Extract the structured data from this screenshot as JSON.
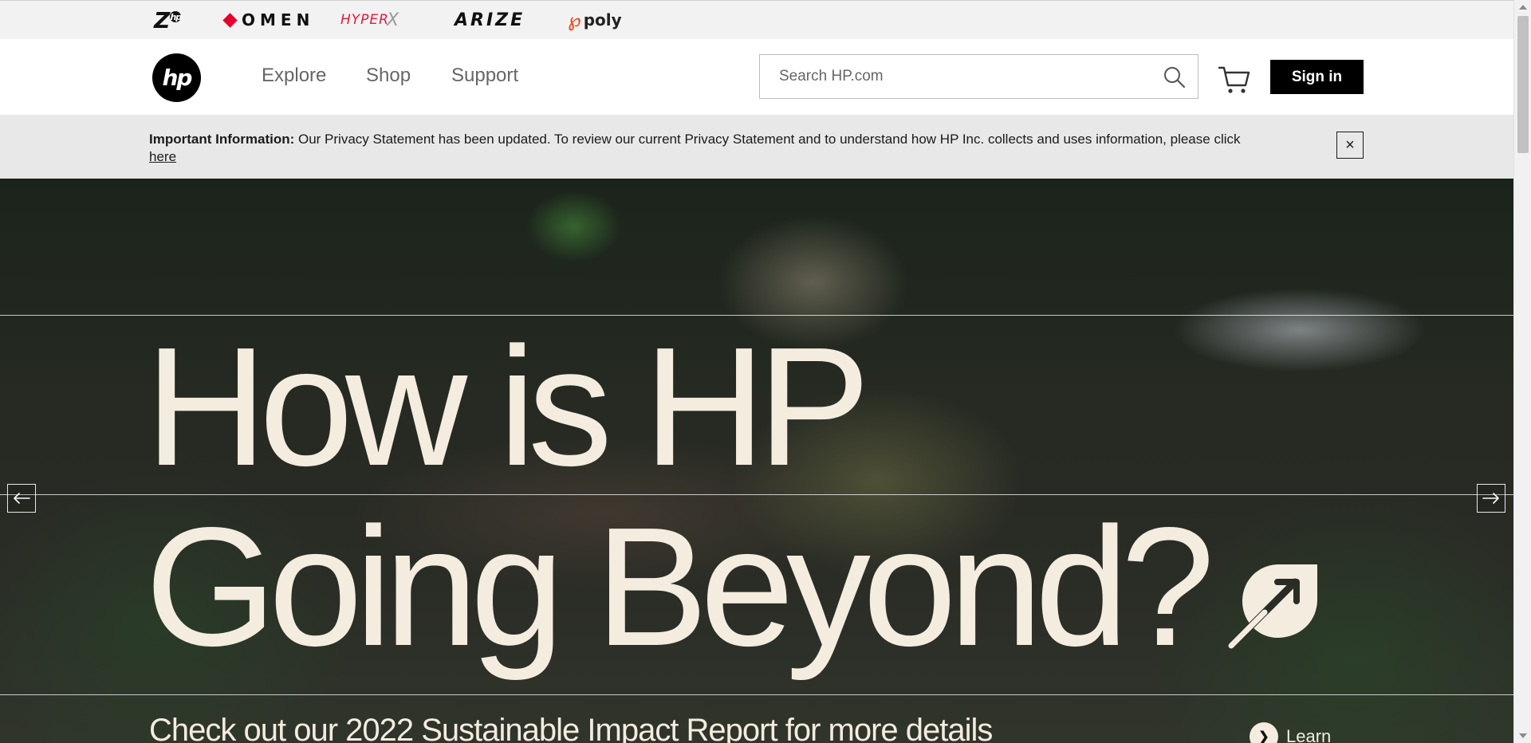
{
  "brands": {
    "z": "Z",
    "z_badge": "hp",
    "omen": "OMEN",
    "hyperx": "HYPER",
    "hyperx_x": "X",
    "arize": "ARIZE",
    "poly": "poly"
  },
  "header": {
    "logo_text": "hp",
    "nav": {
      "explore": "Explore",
      "shop": "Shop",
      "support": "Support"
    },
    "search": {
      "placeholder": "Search HP.com",
      "value": ""
    },
    "signin_label": "Sign in"
  },
  "notice": {
    "label": "Important Information:",
    "text": "Our Privacy Statement has been updated. To review our current Privacy Statement and to understand how HP Inc. collects and uses information, please click",
    "link": "here",
    "close": "×"
  },
  "hero": {
    "headline_line1": "How is HP",
    "headline_line2": "Going Beyond?",
    "subline": "Check out our 2022 Sustainable Impact Report for more details",
    "learn_label": "Learn",
    "learn_glyph": "❯"
  },
  "colors": {
    "hero_text": "#f3ecdf",
    "signin_bg": "#000000",
    "notice_bg": "#e8e8e8",
    "omen_accent": "#e8002d",
    "hyperx_red": "#e31c3d",
    "poly_orange": "#e8562a"
  }
}
